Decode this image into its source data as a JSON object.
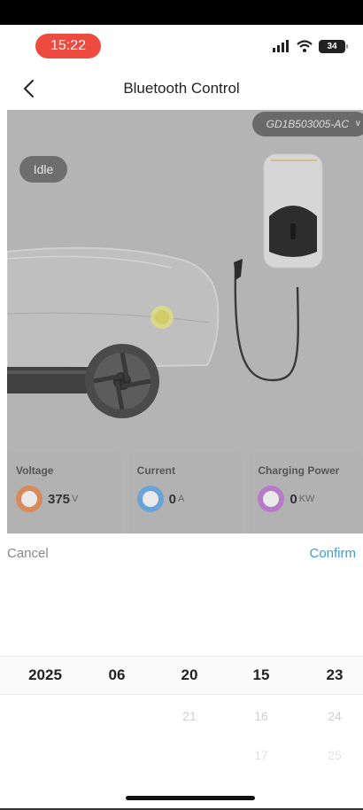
{
  "status_bar": {
    "time": "15:22",
    "battery": "34"
  },
  "nav": {
    "title": "Bluetooth Control"
  },
  "device": {
    "id": "GD1B503005-AC"
  },
  "status": {
    "state": "Idle"
  },
  "stats": [
    {
      "label": "Voltage",
      "value": "375",
      "unit": "V",
      "icon": "voltage-icon",
      "color": "#d88a5a"
    },
    {
      "label": "Current",
      "value": "0",
      "unit": "A",
      "icon": "current-icon",
      "color": "#6aa3d6"
    },
    {
      "label": "Charging Power",
      "value": "0",
      "unit": "KW",
      "icon": "power-icon",
      "color": "#b57bc8"
    }
  ],
  "picker": {
    "cancel_label": "Cancel",
    "confirm_label": "Confirm",
    "columns": [
      {
        "selected": "2025",
        "next": "",
        "next2": ""
      },
      {
        "selected": "06",
        "next": "",
        "next2": ""
      },
      {
        "selected": "20",
        "next": "21",
        "next2": ""
      },
      {
        "selected": "15",
        "next": "16",
        "next2": "17"
      },
      {
        "selected": "23",
        "next": "24",
        "next2": "25"
      }
    ]
  },
  "colors": {
    "time_pill": "#ee4b40",
    "confirm": "#3f9be0"
  }
}
